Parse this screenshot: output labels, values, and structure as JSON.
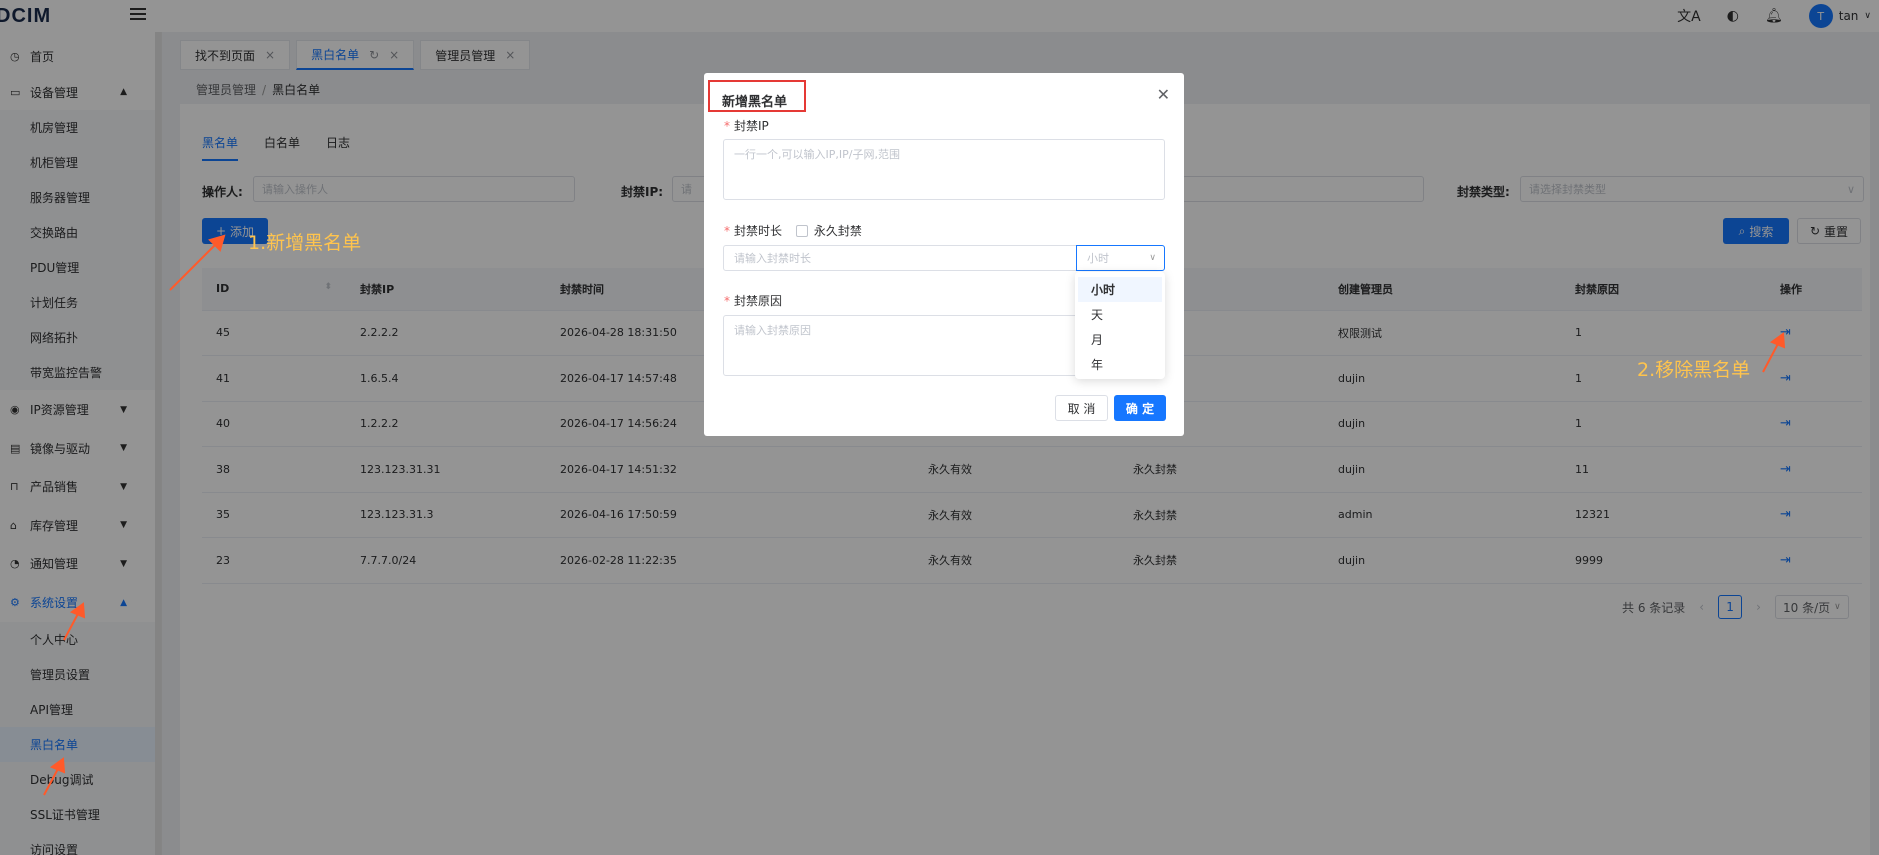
{
  "app": {
    "logo": "DCIM",
    "user": "tan",
    "avatar": "T"
  },
  "sidebar": {
    "items": [
      {
        "label": "首页",
        "icon": "clock-icon"
      },
      {
        "label": "设备管理",
        "icon": "monitor-icon",
        "caret": "▲"
      },
      {
        "label": "IP资源管理",
        "icon": "eye-icon",
        "caret": "▼"
      },
      {
        "label": "镜像与驱动",
        "icon": "book-icon",
        "caret": "▼"
      },
      {
        "label": "产品销售",
        "icon": "bag-icon",
        "caret": "▼"
      },
      {
        "label": "库存管理",
        "icon": "warehouse-icon",
        "caret": "▼"
      },
      {
        "label": "通知管理",
        "icon": "bell-icon",
        "caret": "▼"
      },
      {
        "label": "系统设置",
        "icon": "gear-icon",
        "caret": "▲"
      }
    ],
    "device_sub": [
      "机房管理",
      "机柜管理",
      "服务器管理",
      "交换路由",
      "PDU管理",
      "计划任务",
      "网络拓扑",
      "带宽监控告警"
    ],
    "system_sub": [
      "个人中心",
      "管理员设置",
      "API管理",
      "黑白名单",
      "Debug调试",
      "SSL证书管理",
      "访问设置"
    ]
  },
  "tabs": [
    {
      "label": "找不到页面"
    },
    {
      "label": "黑白名单"
    },
    {
      "label": "管理员管理"
    }
  ],
  "breadcrumb": {
    "parent": "管理员管理",
    "current": "黑白名单"
  },
  "subtabs": [
    "黑名单",
    "白名单",
    "日志"
  ],
  "filters": {
    "operator_label": "操作人:",
    "operator_placeholder": "请输入操作人",
    "ip_label": "封禁IP:",
    "ip_placeholder": "请",
    "type_label": "封禁类型:",
    "type_placeholder": "请选择封禁类型"
  },
  "buttons": {
    "add": "添加",
    "search": "搜索",
    "reset": "重置"
  },
  "table": {
    "headers": [
      "ID",
      "封禁IP",
      "封禁时间",
      "",
      "",
      "创建管理员",
      "封禁原因",
      "操作"
    ],
    "rows": [
      {
        "id": "45",
        "ip": "2.2.2.2",
        "time": "2026-04-28 18:31:50",
        "c4": "",
        "c5": "",
        "admin": "权限测试",
        "reason": "1"
      },
      {
        "id": "41",
        "ip": "1.6.5.4",
        "time": "2026-04-17 14:57:48",
        "c4": "",
        "c5": "",
        "admin": "dujin",
        "reason": "1"
      },
      {
        "id": "40",
        "ip": "1.2.2.2",
        "time": "2026-04-17 14:56:24",
        "c4": "",
        "c5": "",
        "admin": "dujin",
        "reason": "1"
      },
      {
        "id": "38",
        "ip": "123.123.31.31",
        "time": "2026-04-17 14:51:32",
        "c4": "永久有效",
        "c5": "永久封禁",
        "admin": "dujin",
        "reason": "11"
      },
      {
        "id": "35",
        "ip": "123.123.31.3",
        "time": "2026-04-16 17:50:59",
        "c4": "永久有效",
        "c5": "永久封禁",
        "admin": "admin",
        "reason": "12321"
      },
      {
        "id": "23",
        "ip": "7.7.7.0/24",
        "time": "2026-02-28 11:22:35",
        "c4": "永久有效",
        "c5": "永久封禁",
        "admin": "dujin",
        "reason": "9999"
      }
    ]
  },
  "pager": {
    "total": "共 6 条记录",
    "page": "1",
    "size": "10 条/页"
  },
  "modal": {
    "title": "新增黑名单",
    "ip_label": "封禁IP",
    "ip_placeholder": "一行一个,可以输入IP,IP/子网,范围",
    "duration_label": "封禁时长",
    "permanent_label": "永久封禁",
    "duration_placeholder": "请输入封禁时长",
    "unit_placeholder": "小时",
    "unit_options": [
      "小时",
      "天",
      "月",
      "年"
    ],
    "reason_label": "封禁原因",
    "reason_placeholder": "请输入封禁原因",
    "cancel": "取 消",
    "ok": "确 定"
  },
  "annotations": {
    "a1": "1.新增黑名单",
    "a2": "2.移除黑名单"
  },
  "colors": {
    "primary": "#1677ff",
    "annotation": "#ffc44d",
    "highlight": "#e53935"
  }
}
